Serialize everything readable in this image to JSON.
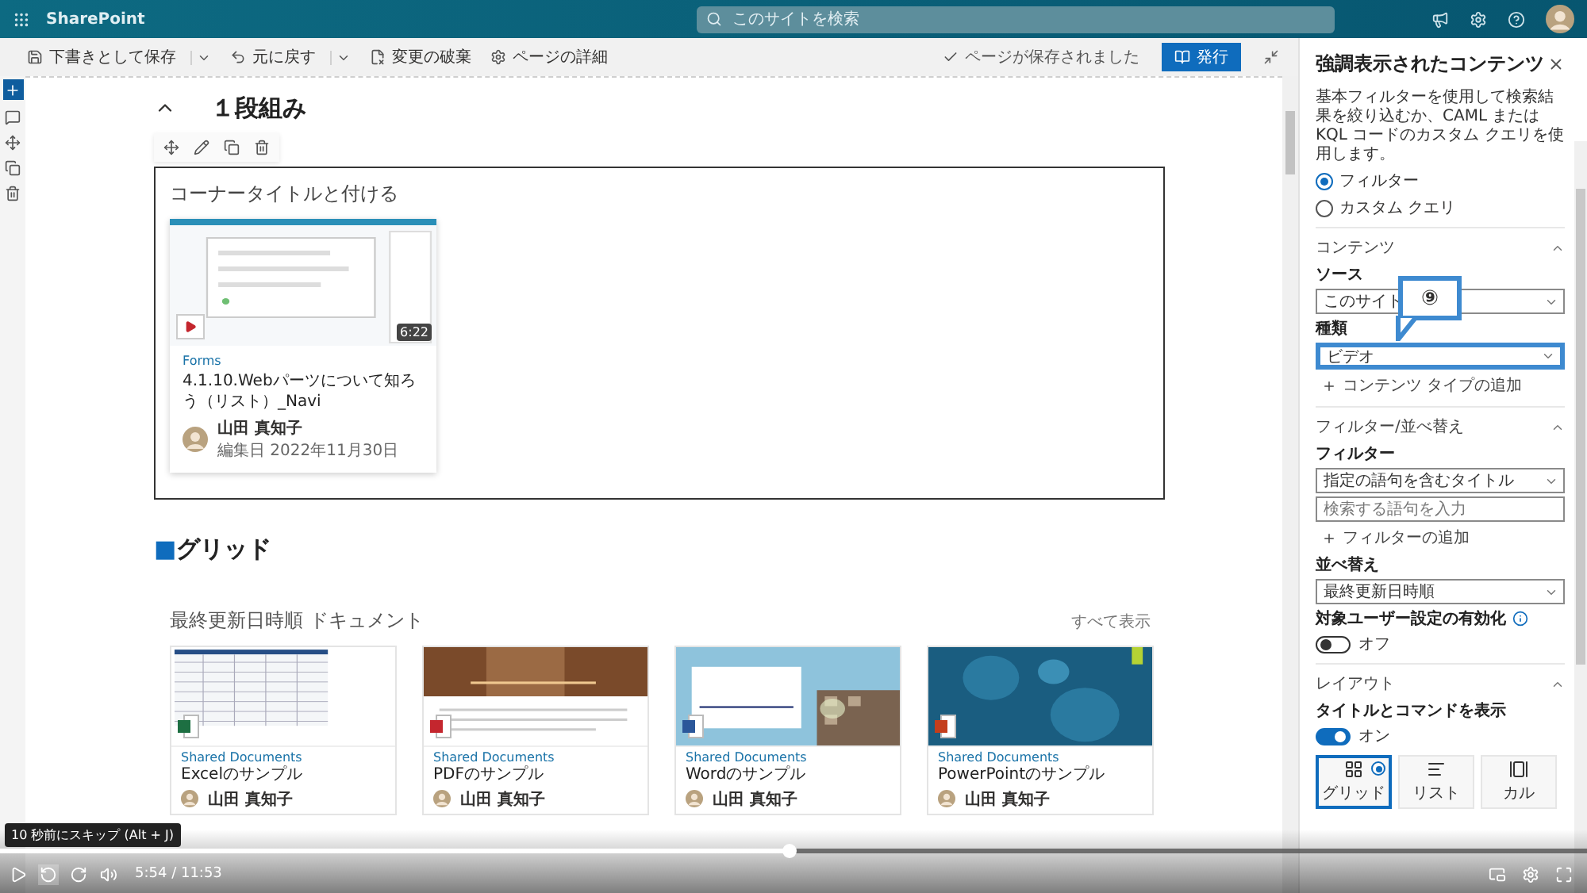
{
  "app_bar": {
    "title": "SharePoint",
    "search_placeholder": "このサイトを検索"
  },
  "command_bar": {
    "items": [
      {
        "label": "下書きとして保存",
        "has_menu": true
      },
      {
        "label": "元に戻す",
        "has_menu": true
      },
      {
        "label": "変更の破棄",
        "has_menu": false
      },
      {
        "label": "ページの詳細",
        "has_menu": false
      }
    ],
    "status": "ページが保存されました",
    "publish": "発行"
  },
  "section": {
    "title": "１段組み",
    "expanded": true
  },
  "webpart": {
    "title": "コーナータイトルと付ける",
    "card": {
      "duration": "6:22",
      "site": "Forms",
      "title": "4.1.10.Webパーツについて知ろう（リスト）_Navi",
      "author": "山田 真知子",
      "date": "編集日 2022年11月30日"
    }
  },
  "grid_heading": {
    "marker": "■",
    "text": "グリッド"
  },
  "documents": {
    "title": "最終更新日時順 ドキュメント",
    "see_all": "すべて表示",
    "items": [
      {
        "kind": "excel",
        "site": "Shared Documents",
        "title": "Excelのサンプル",
        "author": "山田 真知子"
      },
      {
        "kind": "pdf",
        "site": "Shared Documents",
        "title": "PDFのサンプル",
        "author": "山田 真知子"
      },
      {
        "kind": "word",
        "site": "Shared Documents",
        "title": "Wordのサンプル",
        "author": "山田 真知子"
      },
      {
        "kind": "powerpoint",
        "site": "Shared Documents",
        "title": "PowerPointのサンプル",
        "author": "山田 真知子"
      }
    ]
  },
  "panel": {
    "title": "強調表示されたコンテンツ",
    "description": "基本フィルターを使用して検索結果を絞り込むか、CAML または KQL コードのカスタム クエリを使用します。",
    "source_mode": [
      {
        "label": "フィルター",
        "selected": true
      },
      {
        "label": "カスタム クエリ",
        "selected": false
      }
    ],
    "sections": [
      {
        "title": "コンテンツ",
        "expanded": true,
        "fields": [
          {
            "kind": "dropdown",
            "label": "ソース",
            "value": "このサイト",
            "highlighted": false
          },
          {
            "kind": "dropdown",
            "label": "種類",
            "value": "ビデオ",
            "highlighted": true,
            "callout": "⑨"
          },
          {
            "kind": "add",
            "label": "コンテンツ タイプの追加"
          }
        ]
      },
      {
        "title": "フィルター/並べ替え",
        "expanded": true,
        "fields": [
          {
            "kind": "dropdown",
            "label": "フィルター",
            "value": "指定の語句を含むタイトル",
            "highlighted": false
          },
          {
            "kind": "input",
            "placeholder": "検索する語句を入力"
          },
          {
            "kind": "add",
            "label": "フィルターの追加"
          },
          {
            "kind": "dropdown",
            "label": "並べ替え",
            "value": "最終更新日時順",
            "highlighted": false
          },
          {
            "kind": "toggle",
            "label": "対象ユーザー設定の有効化",
            "info": true,
            "on": false,
            "state_label": "オフ"
          }
        ]
      },
      {
        "title": "レイアウト",
        "expanded": true,
        "fields": [
          {
            "kind": "toggle",
            "label": "タイトルとコマンドを表示",
            "info": false,
            "on": true,
            "state_label": "オン"
          },
          {
            "kind": "layouts",
            "options": [
              {
                "label": "グリッド",
                "selected": true
              },
              {
                "label": "リスト",
                "selected": false
              },
              {
                "label": "カル",
                "selected": false
              }
            ]
          }
        ]
      }
    ]
  },
  "player": {
    "progress": {
      "level": 0.497
    },
    "time": "5:54 / 11:53",
    "tooltip": "10 秒前にスキップ (Alt + J)"
  }
}
